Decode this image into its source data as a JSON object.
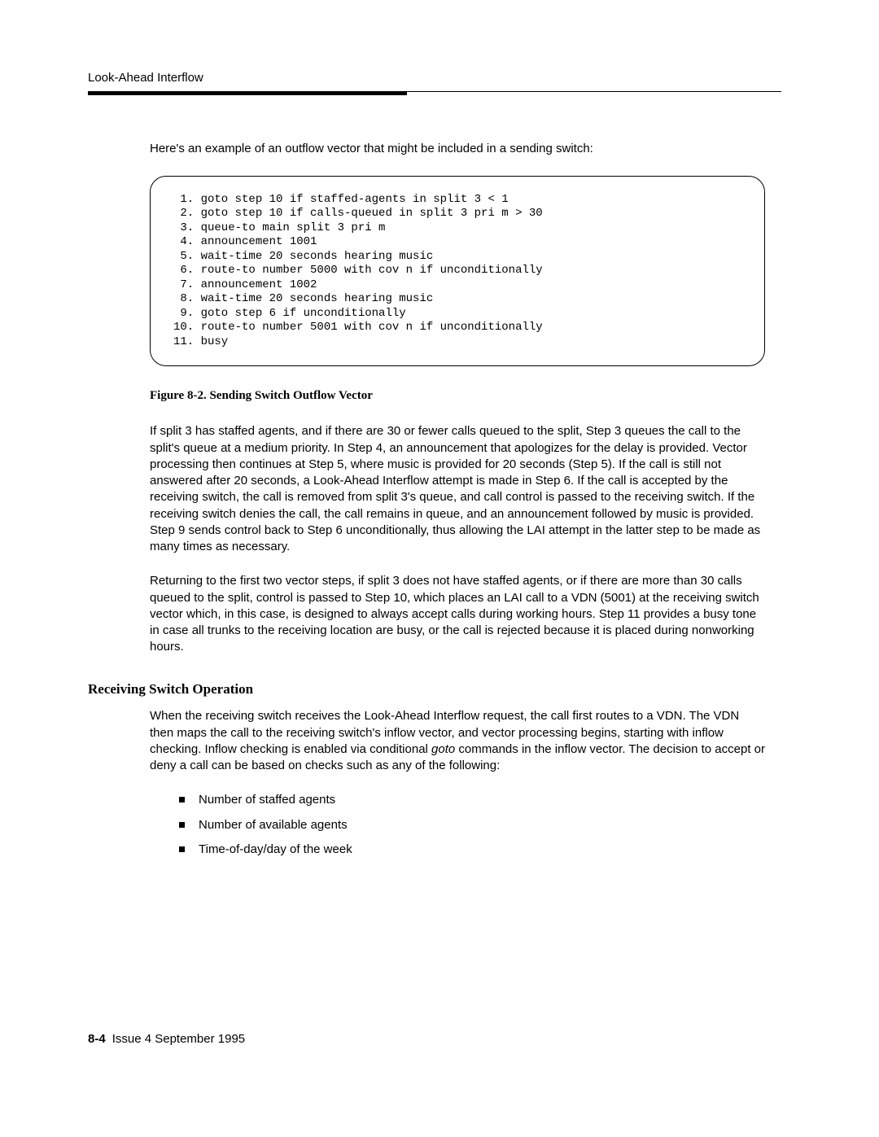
{
  "header": {
    "running_head": "Look-Ahead Interflow"
  },
  "intro": "Here's an example of an outflow vector that might be included in a sending switch:",
  "vector_steps": " 1. goto step 10 if staffed-agents in split 3 < 1\n 2. goto step 10 if calls-queued in split 3 pri m > 30\n 3. queue-to main split 3 pri m\n 4. announcement 1001\n 5. wait-time 20 seconds hearing music\n 6. route-to number 5000 with cov n if unconditionally\n 7. announcement 1002\n 8. wait-time 20 seconds hearing music\n 9. goto step 6 if unconditionally\n10. route-to number 5001 with cov n if unconditionally\n11. busy",
  "figure_caption": "Figure 8-2.    Sending Switch Outflow Vector",
  "paragraph_1": "If split 3 has staffed agents, and if there are 30 or fewer calls queued to the split, Step 3 queues the call to the split's queue at a medium priority. In Step 4, an announcement that apologizes for the delay is provided. Vector processing then continues at Step 5, where music is provided for 20 seconds (Step 5). If the call is still not answered after 20 seconds, a Look-Ahead Interflow attempt is made in Step 6. If the call is accepted by the receiving switch, the call is removed from split 3's queue, and call control is passed to the receiving switch. If the receiving switch denies the call, the call remains in queue, and an announcement followed by music is provided. Step 9 sends control back to Step 6 unconditionally, thus allowing the LAI attempt in the latter step to be made as many times as necessary.",
  "paragraph_2": "Returning to the first two vector steps, if split 3 does not have staffed agents, or if there are more than 30 calls queued to the split, control is passed to Step 10, which places an LAI call to a VDN (5001) at the receiving switch vector which, in this case, is designed to always accept calls during working hours. Step 11 provides a busy tone in case all trunks to the receiving location are busy, or the call is rejected because it is placed during nonworking hours.",
  "section_heading": "Receiving Switch Operation",
  "paragraph_3_a": "When the receiving switch receives the Look-Ahead Interflow request, the call first routes to a VDN. The VDN then maps the call to the receiving switch's inflow vector, and vector processing begins, starting with inflow checking. Inflow checking is enabled via conditional ",
  "paragraph_3_goto": "goto",
  "paragraph_3_b": " commands in the inflow vector. The decision to accept or deny a call can be based on checks such as any of the following:",
  "bullets": [
    "Number of staffed agents",
    "Number of available agents",
    "Time-of-day/day of the week"
  ],
  "footer": {
    "page_number": "8-4",
    "issue": "Issue  4  September 1995"
  }
}
